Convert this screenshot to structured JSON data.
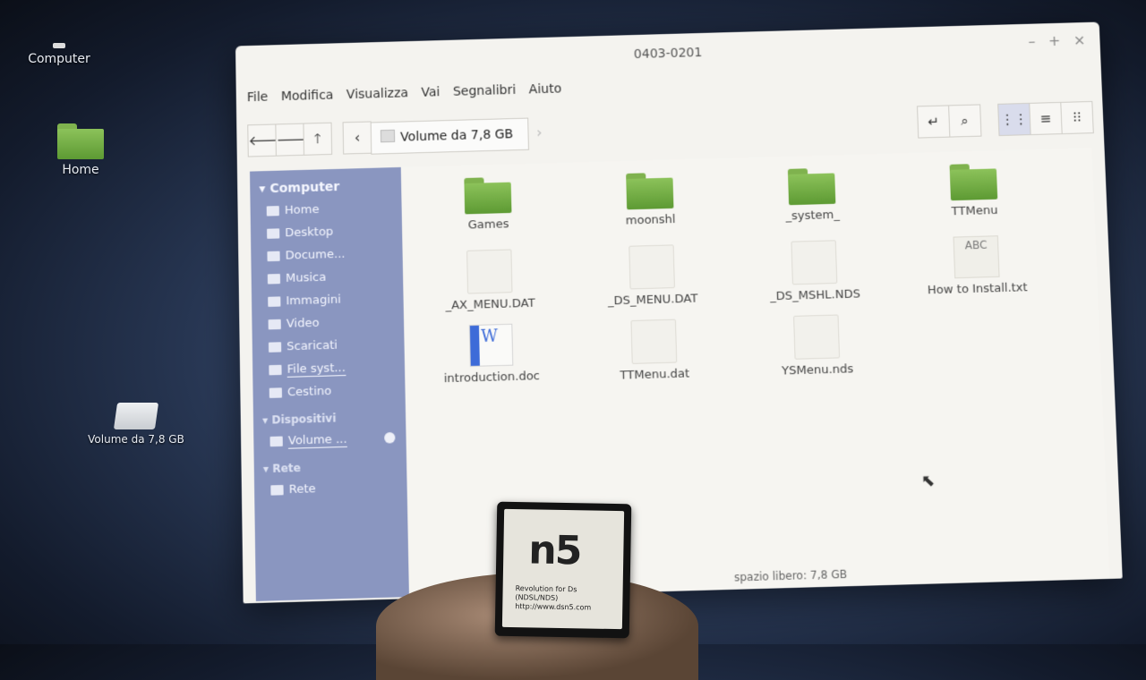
{
  "desktop": {
    "computer_label": "Computer",
    "home_label": "Home",
    "volume_label": "Volume da 7,8 GB"
  },
  "window": {
    "title": "0403-0201",
    "controls": {
      "minimize": "–",
      "maximize": "+",
      "close": "×"
    }
  },
  "menu": [
    "File",
    "Modifica",
    "Visualizza",
    "Vai",
    "Segnalibri",
    "Aiuto"
  ],
  "path": {
    "current": "Volume da 7,8 GB"
  },
  "sidebar": {
    "header": "Computer",
    "places": [
      "Home",
      "Desktop",
      "Docume...",
      "Musica",
      "Immagini",
      "Video",
      "Scaricati",
      "File syst...",
      "Cestino"
    ],
    "devices_header": "Dispositivi",
    "device": "Volume ...",
    "network_header": "Rete",
    "network_item": "Rete"
  },
  "files": [
    {
      "name": "Games",
      "type": "folder"
    },
    {
      "name": "moonshl",
      "type": "folder"
    },
    {
      "name": "_system_",
      "type": "folder"
    },
    {
      "name": "TTMenu",
      "type": "folder"
    },
    {
      "name": "_AX_MENU.DAT",
      "type": "file"
    },
    {
      "name": "_DS_MENU.DAT",
      "type": "file"
    },
    {
      "name": "_DS_MSHL.NDS",
      "type": "file"
    },
    {
      "name": "How to Install.txt",
      "type": "text"
    },
    {
      "name": "introduction.doc",
      "type": "word"
    },
    {
      "name": "TTMenu.dat",
      "type": "file"
    },
    {
      "name": "YSMenu.nds",
      "type": "file"
    }
  ],
  "text_icon_glyph": "ABC",
  "word_icon_glyph": "W",
  "status": "spazio libero: 7,8 GB",
  "card": {
    "logo": "n5",
    "line1": "Revolution for Ds",
    "line2": "(NDSL/NDS)",
    "line3": "http://www.dsn5.com"
  }
}
